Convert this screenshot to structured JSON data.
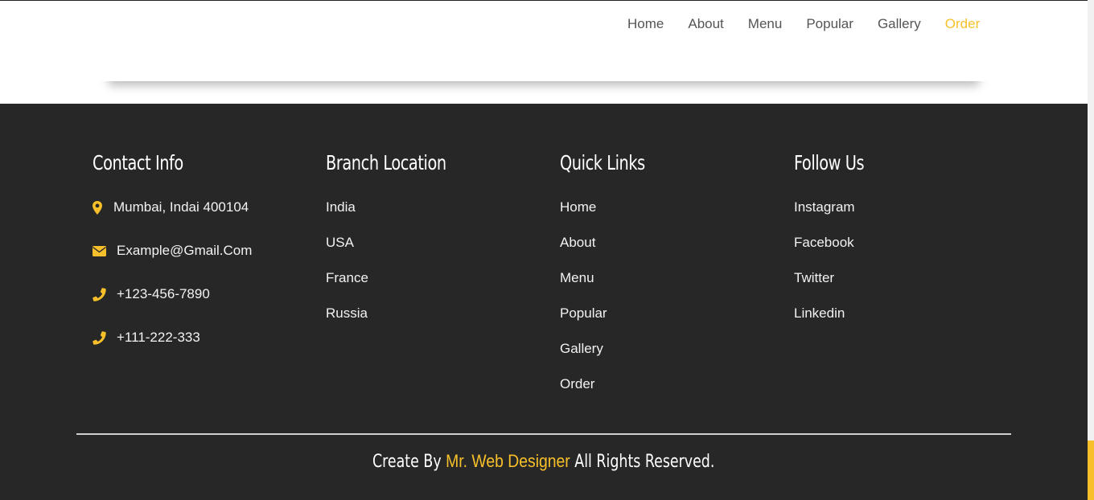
{
  "header": {
    "nav": [
      {
        "label": "Home"
      },
      {
        "label": "About"
      },
      {
        "label": "Menu"
      },
      {
        "label": "Popular"
      },
      {
        "label": "Gallery"
      },
      {
        "label": "Order",
        "active": true
      }
    ]
  },
  "footer": {
    "contact": {
      "title": "Contact Info",
      "items": [
        {
          "icon": "map-marker-icon",
          "text": "Mumbai, Indai 400104"
        },
        {
          "icon": "envelope-icon",
          "text": "Example@Gmail.Com"
        },
        {
          "icon": "phone-icon",
          "text": "+123-456-7890"
        },
        {
          "icon": "phone-icon",
          "text": "+111-222-333"
        }
      ]
    },
    "branch": {
      "title": "Branch Location",
      "items": [
        "India",
        "USA",
        "France",
        "Russia"
      ]
    },
    "quick": {
      "title": "Quick Links",
      "items": [
        "Home",
        "About",
        "Menu",
        "Popular",
        "Gallery",
        "Order"
      ]
    },
    "follow": {
      "title": "Follow Us",
      "items": [
        "Instagram",
        "Facebook",
        "Twitter",
        "Linkedin"
      ]
    },
    "credit": {
      "prefix": "Create By",
      "author": "Mr. Web Designer",
      "suffix": "All Rights Reserved."
    }
  },
  "colors": {
    "accent": "#f7c02a",
    "footer_bg": "#272727",
    "nav_text": "#555555"
  }
}
